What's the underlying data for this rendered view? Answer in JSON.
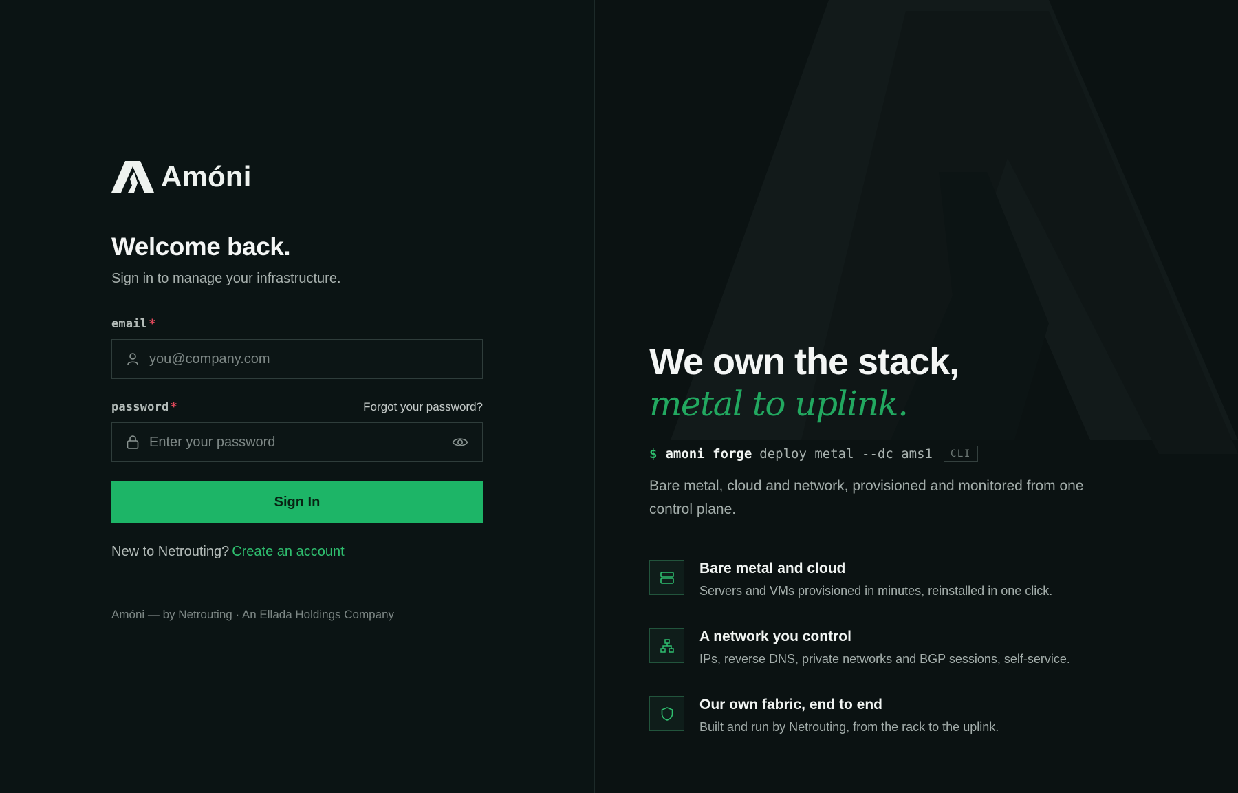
{
  "colors": {
    "accent": "#1db567",
    "accent_text": "#2fbf6f",
    "required": "#e0485a",
    "background": "#0b1313"
  },
  "brand": {
    "logo_icon": "amoni-a-mark-icon",
    "name": "Amóni"
  },
  "login": {
    "title": "Welcome back.",
    "subtitle": "Sign in to manage your infrastructure.",
    "email": {
      "label": "email",
      "required_mark": "*",
      "icon": "user-icon",
      "value": "",
      "placeholder": "you@company.com"
    },
    "password": {
      "label": "password",
      "required_mark": "*",
      "forgot_link": "Forgot your password?",
      "icon": "lock-icon",
      "toggle_icon": "eye-icon",
      "value": "",
      "placeholder": "Enter your password"
    },
    "submit_label": "Sign In",
    "new_prompt": "New to Netrouting?",
    "create_link": "Create an account",
    "footer": "Amóni — by Netrouting · An Ellada Holdings Company"
  },
  "hero": {
    "headline": "We own the stack,",
    "headline_italic": "metal to uplink.",
    "cli": {
      "prompt": "$",
      "command": "amoni forge",
      "args": "deploy metal --dc ams1",
      "badge": "CLI"
    },
    "description": "Bare metal, cloud and network, provisioned and monitored from one control plane.",
    "features": [
      {
        "icon": "server-icon",
        "title": "Bare metal and cloud",
        "description": "Servers and VMs provisioned in minutes, reinstalled in one click."
      },
      {
        "icon": "network-icon",
        "title": "A network you control",
        "description": "IPs, reverse DNS, private networks and BGP sessions, self-service."
      },
      {
        "icon": "shield-icon",
        "title": "Our own fabric, end to end",
        "description": "Built and run by Netrouting, from the rack to the uplink."
      }
    ]
  }
}
